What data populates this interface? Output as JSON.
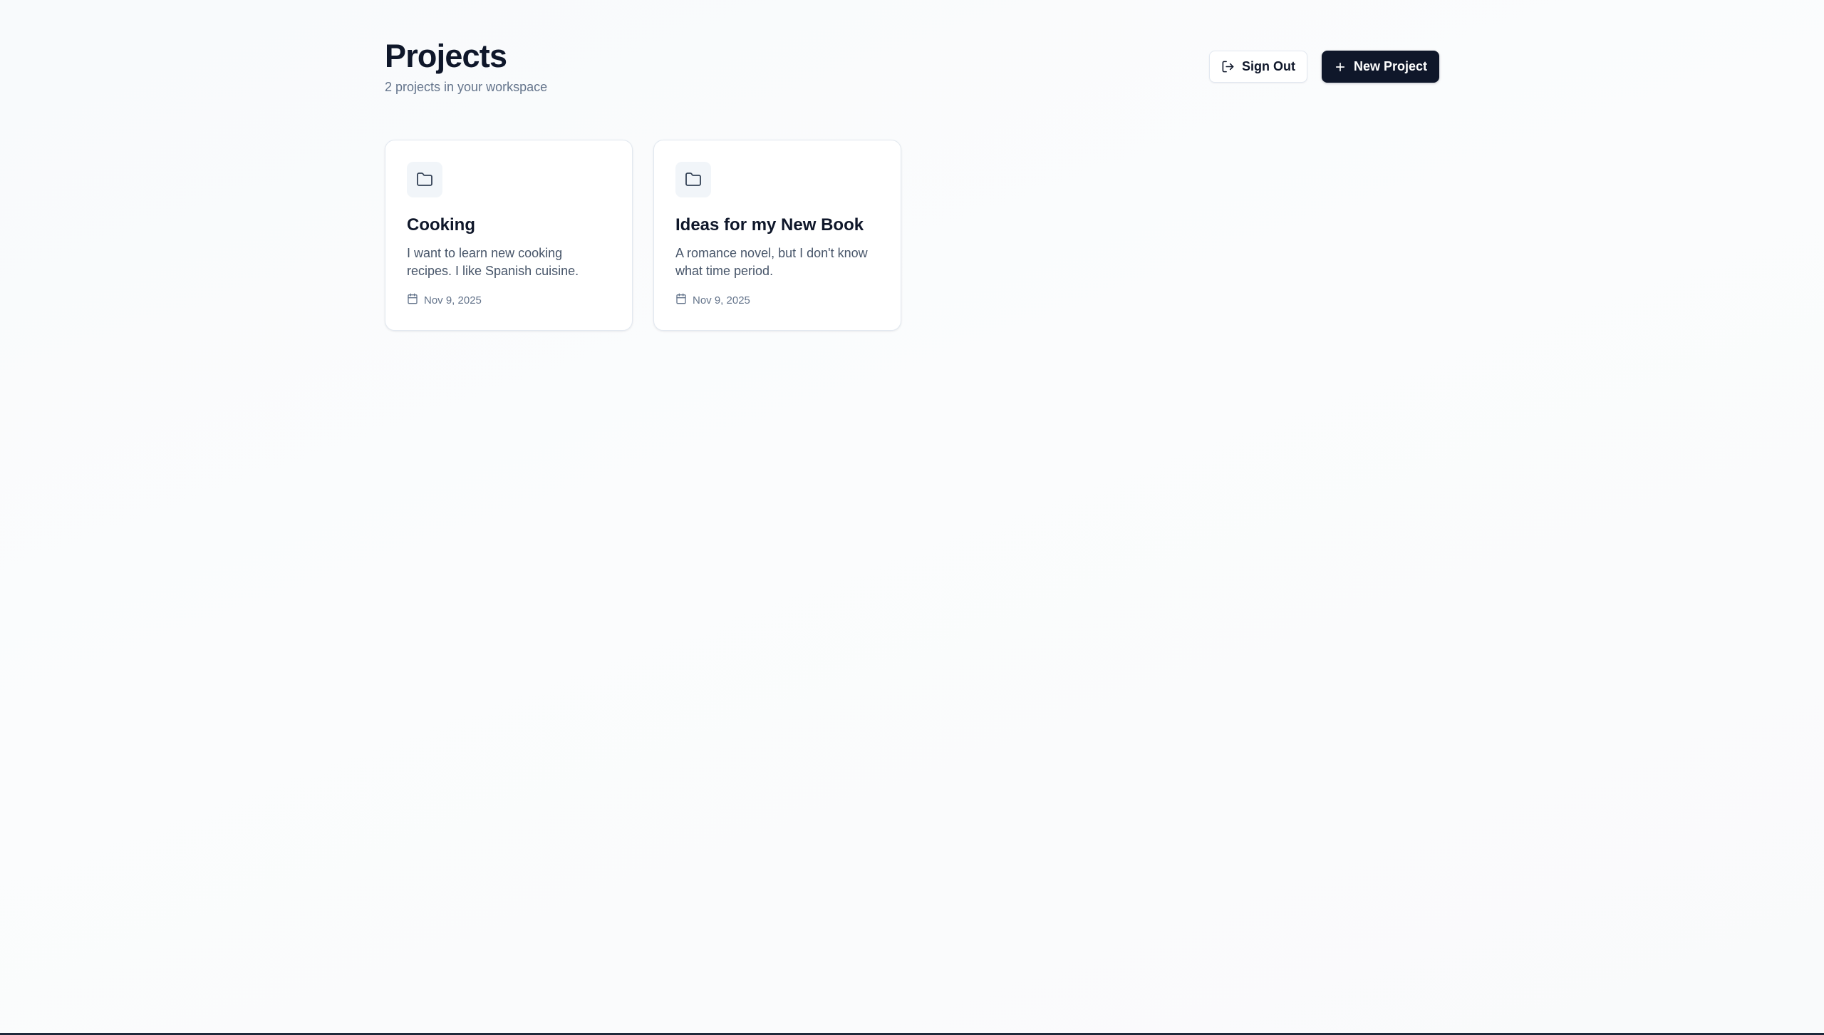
{
  "header": {
    "title": "Projects",
    "subtitle": "2 projects in your workspace",
    "sign_out_label": "Sign Out",
    "new_project_label": "New Project"
  },
  "projects": [
    {
      "title": "Cooking",
      "description": "I want to learn new cooking recipes. I like Spanish cuisine.",
      "date": "Nov 9, 2025",
      "icon": "folder-icon"
    },
    {
      "title": "Ideas for my New Book",
      "description": "A romance novel, but I don't know what time period.",
      "date": "Nov 9, 2025",
      "icon": "folder-icon"
    }
  ],
  "colors": {
    "primary": "#0f172a",
    "muted_text": "#64748b",
    "border": "#e2e8f0",
    "icon_bg": "#f1f5f9"
  }
}
